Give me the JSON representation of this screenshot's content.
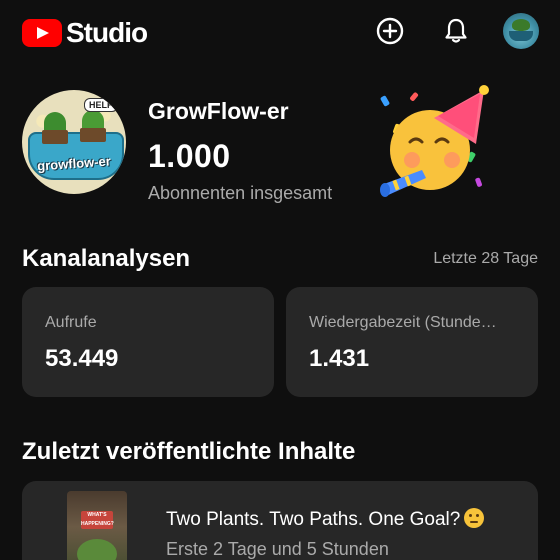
{
  "app": {
    "title": "Studio"
  },
  "header": {
    "create_icon": "plus-circle-icon",
    "notifications_icon": "bell-icon",
    "account_icon": "avatar"
  },
  "channel": {
    "name": "GrowFlow-er",
    "avatar_text_help": "HELP",
    "avatar_text_logo": "growflow-er",
    "subscriber_count": "1.000",
    "subscriber_label": "Abonnenten insgesamt",
    "celebration_icon": "party-face-icon"
  },
  "analytics": {
    "title": "Kanalanalysen",
    "range": "Letzte 28 Tage",
    "cards": [
      {
        "label": "Aufrufe",
        "value": "53.449"
      },
      {
        "label": "Wiedergabezeit (Stunde…",
        "value": "1.431"
      }
    ]
  },
  "recent": {
    "title": "Zuletzt veröffentlichte Inhalte",
    "items": [
      {
        "title": "Two Plants. Two Paths. One Goal?",
        "title_emoji": "thinking-face-icon",
        "meta": "Erste 2 Tage und 5 Stunden",
        "thumb_badge": "WHAT'S HAPPENING?"
      }
    ]
  },
  "colors": {
    "background": "#0f0f0f",
    "card": "#272727",
    "brand_red": "#ff0000",
    "secondary_text": "#aaaaaa"
  }
}
